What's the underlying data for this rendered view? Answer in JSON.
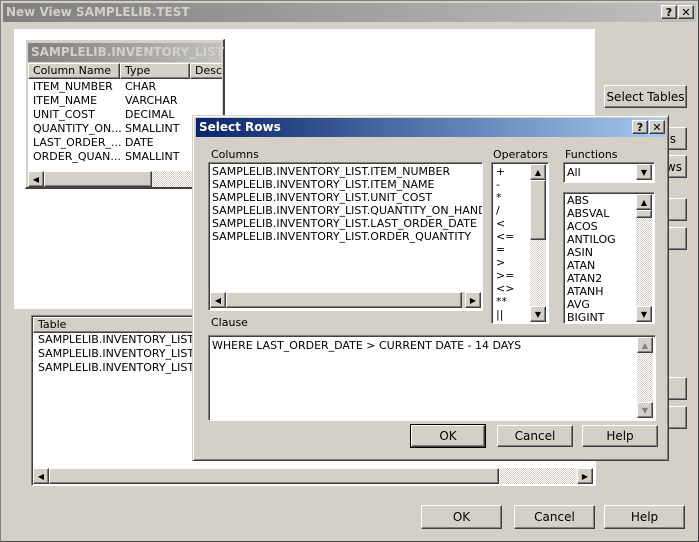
{
  "main_window": {
    "title": "New View SAMPLELIB.TEST",
    "help_btn": "?",
    "close_btn": "✕",
    "select_tables_label": "Select Tables",
    "ok_label": "OK",
    "cancel_label": "Cancel",
    "help_label": "Help",
    "hidden_button_fragments": [
      "s",
      "ws"
    ]
  },
  "table_card": {
    "title": "SAMPLELIB.INVENTORY_LIST",
    "columns": [
      "Column Name",
      "Type",
      "Descr"
    ],
    "rows": [
      {
        "name": "ITEM_NUMBER",
        "type": "CHAR"
      },
      {
        "name": "ITEM_NAME",
        "type": "VARCHAR"
      },
      {
        "name": "UNIT_COST",
        "type": "DECIMAL"
      },
      {
        "name": "QUANTITY_ON...",
        "type": "SMALLINT"
      },
      {
        "name": "LAST_ORDER_...",
        "type": "DATE"
      },
      {
        "name": "ORDER_QUAN...",
        "type": "SMALLINT"
      }
    ]
  },
  "table_list": {
    "header": "Table",
    "rows": [
      "SAMPLELIB.INVENTORY_LIST",
      "SAMPLELIB.INVENTORY_LIST",
      "SAMPLELIB.INVENTORY_LIST"
    ]
  },
  "select_rows": {
    "title": "Select Rows",
    "help_btn": "?",
    "close_btn": "✕",
    "columns_label": "Columns",
    "columns": [
      "SAMPLELIB.INVENTORY_LIST.ITEM_NUMBER",
      "SAMPLELIB.INVENTORY_LIST.ITEM_NAME",
      "SAMPLELIB.INVENTORY_LIST.UNIT_COST",
      "SAMPLELIB.INVENTORY_LIST.QUANTITY_ON_HAND",
      "SAMPLELIB.INVENTORY_LIST.LAST_ORDER_DATE",
      "SAMPLELIB.INVENTORY_LIST.ORDER_QUANTITY"
    ],
    "operators_label": "Operators",
    "operators": [
      "+",
      "-",
      "*",
      "/",
      "<",
      "<=",
      "=",
      ">",
      ">=",
      "<>",
      "**",
      "||"
    ],
    "functions_label": "Functions",
    "functions_filter": "All",
    "functions": [
      "ABS",
      "ABSVAL",
      "ACOS",
      "ANTILOG",
      "ASIN",
      "ATAN",
      "ATAN2",
      "ATANH",
      "AVG",
      "BIGINT"
    ],
    "clause_label": "Clause",
    "clause_value": "WHERE LAST_ORDER_DATE > CURRENT DATE - 14 DAYS",
    "ok_label": "OK",
    "cancel_label": "Cancel",
    "help_label": "Help"
  },
  "colors": {
    "title_inactive_start": "#808080",
    "title_inactive_end": "#c0c0c0",
    "title_active_start": "#0a246a",
    "title_active_end": "#a6caf0",
    "face": "#d4d0c8"
  }
}
